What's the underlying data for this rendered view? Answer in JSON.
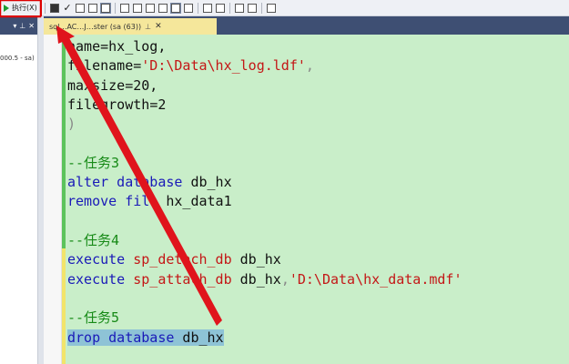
{
  "toolbar": {
    "execute_label": "执行(X)"
  },
  "left_panel": {
    "header_controls": [
      "▾",
      "⊥",
      "✕"
    ],
    "tree_item": "000.5 - sa)"
  },
  "tab": {
    "title": "sql…AC…J…ster (sa (63))",
    "pin": "⊥",
    "close": "✕"
  },
  "code_lines": [
    {
      "parts": [
        {
          "t": "name",
          "c": ""
        },
        {
          "t": "=hx_log,",
          "c": ""
        }
      ]
    },
    {
      "parts": [
        {
          "t": "filename",
          "c": ""
        },
        {
          "t": "=",
          "c": ""
        },
        {
          "t": "'D:\\Data\\hx_log.ldf'",
          "c": "str"
        },
        {
          "t": ",",
          "c": "gray"
        }
      ]
    },
    {
      "parts": [
        {
          "t": "maxsize",
          "c": ""
        },
        {
          "t": "=20,",
          "c": ""
        }
      ]
    },
    {
      "parts": [
        {
          "t": "filegrowth",
          "c": ""
        },
        {
          "t": "=2",
          "c": ""
        }
      ]
    },
    {
      "parts": [
        {
          "t": ")",
          "c": "gray"
        }
      ]
    },
    {
      "parts": []
    },
    {
      "parts": [
        {
          "t": "--任务3",
          "c": "cm"
        }
      ]
    },
    {
      "parts": [
        {
          "t": "alter database",
          "c": "kw"
        },
        {
          "t": " db_hx",
          "c": ""
        }
      ]
    },
    {
      "parts": [
        {
          "t": "remove file",
          "c": "kw"
        },
        {
          "t": " hx_data1",
          "c": ""
        }
      ]
    },
    {
      "parts": []
    },
    {
      "parts": [
        {
          "t": "--任务4",
          "c": "cm"
        }
      ]
    },
    {
      "parts": [
        {
          "t": "execute",
          "c": "kw"
        },
        {
          "t": " ",
          "c": ""
        },
        {
          "t": "sp_detach_db",
          "c": "str"
        },
        {
          "t": " db_hx",
          "c": ""
        }
      ]
    },
    {
      "parts": [
        {
          "t": "execute",
          "c": "kw"
        },
        {
          "t": " ",
          "c": ""
        },
        {
          "t": "sp_attach_db",
          "c": "str"
        },
        {
          "t": " db_hx",
          "c": ""
        },
        {
          "t": ",",
          "c": "gray"
        },
        {
          "t": "'D:\\Data\\hx_data.mdf'",
          "c": "str"
        }
      ]
    },
    {
      "parts": []
    },
    {
      "parts": [
        {
          "t": "--任务5",
          "c": "cm"
        }
      ]
    },
    {
      "parts": [
        {
          "t": "drop database",
          "c": "kw"
        },
        {
          "t": " db_hx",
          "c": ""
        }
      ],
      "selected": true
    }
  ],
  "colors": {
    "editor_bg": "#c9eec9",
    "keyword": "#1a1ab8",
    "string": "#c41717",
    "comment": "#178a17",
    "selection": "#8ec3d6",
    "annotation_arrow": "#e0141c",
    "annotation_box": "#dd0000",
    "tab_active": "#f5e79b",
    "header_dark": "#3e4f73"
  }
}
